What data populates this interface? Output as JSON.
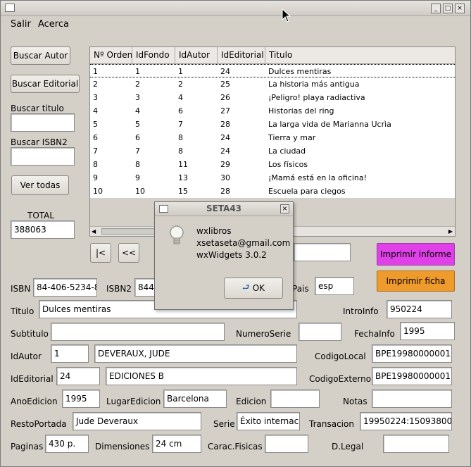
{
  "menu": {
    "items": [
      "Salir",
      "Acerca"
    ]
  },
  "left_panel": {
    "buscar_autor": "Buscar Autor",
    "buscar_editorial": "Buscar Editorial",
    "buscar_titulo_label": "Buscar titulo",
    "buscar_titulo_value": "",
    "buscar_isbn2_label": "Buscar ISBN2",
    "buscar_isbn2_value": "",
    "ver_todas": "Ver todas",
    "total_label": "TOTAL",
    "total_value": "388063"
  },
  "grid": {
    "columns": [
      "Nº Orden",
      "IdFondo",
      "IdAutor",
      "IdEditorial",
      "Titulo"
    ],
    "rows": [
      [
        "1",
        "1",
        "1",
        "24",
        "Dulces mentiras"
      ],
      [
        "2",
        "2",
        "2",
        "25",
        "La historia más antigua"
      ],
      [
        "3",
        "3",
        "4",
        "26",
        "¡Peligro! playa radiactiva"
      ],
      [
        "4",
        "4",
        "6",
        "27",
        "Historias del ring"
      ],
      [
        "5",
        "5",
        "7",
        "28",
        "La larga vida de Marianna Ucrìa"
      ],
      [
        "6",
        "6",
        "8",
        "24",
        "Tierra y mar"
      ],
      [
        "7",
        "7",
        "8",
        "24",
        "La ciudad"
      ],
      [
        "8",
        "8",
        "11",
        "29",
        "Los físicos"
      ],
      [
        "9",
        "9",
        "13",
        "30",
        "¡Mamá está en la oficina!"
      ],
      [
        "10",
        "10",
        "15",
        "28",
        "Escuela para ciegos"
      ]
    ]
  },
  "nav": {
    "first": "|<",
    "prev": "<<"
  },
  "actions": {
    "imprimir_informe": "Imprimir informe",
    "imprimir_ficha": "Imprimir ficha"
  },
  "colors": {
    "imprimir_informe": "#e040e8",
    "imprimir_ficha": "#ee9a2c"
  },
  "dialog": {
    "title": "SETA43",
    "line1": "wxlibros",
    "line2": "xsetaseta@gmail.com",
    "line3": "wxWidgets 3.0.2",
    "ok": "OK",
    "icon": "lightbulb-icon"
  },
  "form": {
    "isbn_label": "ISBN",
    "isbn_value": "84-406-5234-8",
    "isbn2_label": "ISBN2",
    "isbn2_value": "844",
    "pais_label": "Pais",
    "pais_value": "esp",
    "titulo_label": "Titulo",
    "titulo_value": "Dulces mentiras",
    "introinfo_label": "IntroInfo",
    "introinfo_value": "950224",
    "subtitulo_label": "Subtitulo",
    "subtitulo_value": "",
    "numeroserie_label": "NumeroSerie",
    "numeroserie_value": "",
    "fechainfo_label": "FechaInfo",
    "fechainfo_value": "1995",
    "idautor_label": "IdAutor",
    "idautor_value": "1",
    "autor_name": "DEVERAUX, JUDE",
    "codigolocal_label": "CodigoLocal",
    "codigolocal_value": "BPE19980000001",
    "ideditorial_label": "IdEditorial",
    "ideditorial_value": "24",
    "editorial_name": "EDICIONES B",
    "codigoexterno_label": "CodigoExterno",
    "codigoexterno_value": "BPE19980000001",
    "anoedicion_label": "AnoEdicion",
    "anoedicion_value": "1995",
    "lugaredicion_label": "LugarEdicion",
    "lugaredicion_value": "Barcelona",
    "edicion_label": "Edicion",
    "edicion_value": "",
    "notas_label": "Notas",
    "notas_value": "",
    "restoportada_label": "RestoPortada",
    "restoportada_value": "Jude Deveraux",
    "serie_label": "Serie",
    "serie_value": "Éxito internacio",
    "transaccion_label": "Transacion",
    "transaccion_value": "19950224:15093800",
    "paginas_label": "Paginas",
    "paginas_value": "430 p.",
    "dimensiones_label": "Dimensiones",
    "dimensiones_value": "24 cm",
    "caracfisicas_label": "Carac.Fisicas",
    "caracfisicas_value": "",
    "dlegal_label": "D.Legal",
    "dlegal_value": ""
  }
}
